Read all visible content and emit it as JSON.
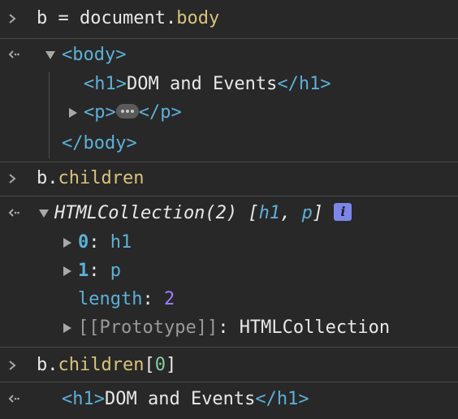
{
  "entries": {
    "cmd1": {
      "var": "b",
      "op": " = ",
      "obj": "document",
      "dot": ".",
      "prop": "body"
    },
    "res1": {
      "open_tag": "<body>",
      "h1_open": "<h1>",
      "h1_text": "DOM and Events",
      "h1_close": "</h1>",
      "p_open": "<p>",
      "p_close": "</p>",
      "close_tag": "</body>"
    },
    "cmd2": {
      "var": "b",
      "dot": ".",
      "prop": "children"
    },
    "res2": {
      "type": "HTMLCollection(2)",
      "preview_open": "[",
      "preview_h1": "h1",
      "preview_comma": ", ",
      "preview_p": "p",
      "preview_close": "]",
      "info_icon": "i",
      "items": [
        {
          "key": "0",
          "colon": ": ",
          "value": "h1"
        },
        {
          "key": "1",
          "colon": ": ",
          "value": "p"
        }
      ],
      "length_key": "length",
      "length_colon": ": ",
      "length_value": "2",
      "proto_key": "[[Prototype]]",
      "proto_colon": ": ",
      "proto_value": "HTMLCollection"
    },
    "cmd3": {
      "var": "b",
      "dot": ".",
      "prop": "children",
      "bracket_open": "[",
      "index": "0",
      "bracket_close": "]"
    },
    "res3": {
      "h1_open": "<h1>",
      "h1_text": "DOM and Events",
      "h1_close": "</h1>"
    }
  },
  "icons": {
    "prompt": "chevron-right-icon",
    "result": "return-arrow-icon",
    "expand": "triangle-right-icon",
    "collapse": "triangle-down-icon"
  },
  "colors": {
    "background": "#282828",
    "tag": "#5db0d7",
    "property": "#d9c27b",
    "number": "#9980ff",
    "info_badge": "#7d86e8"
  }
}
